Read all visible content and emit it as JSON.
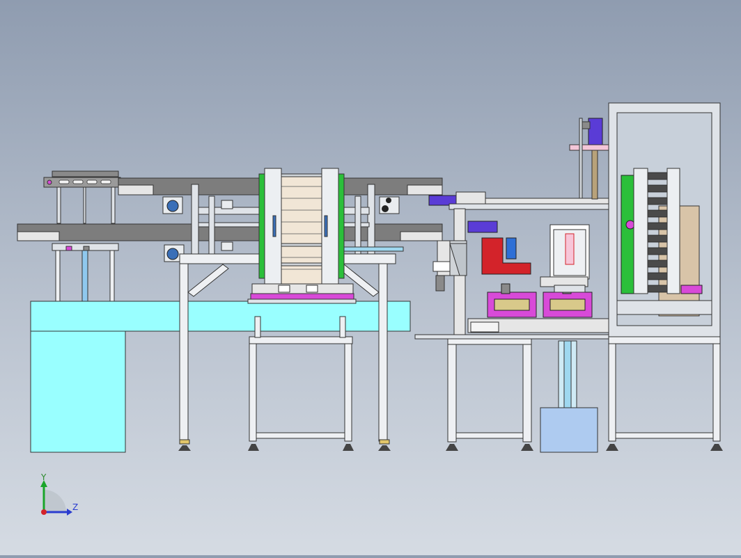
{
  "triad": {
    "y_label": "Y",
    "z_label": "Z"
  },
  "colors": {
    "frame": "#dfe3e8",
    "frame_stroke": "#4a4a4a",
    "table_cyan": "#99ffff",
    "conveyor_gray": "#7d7d7d",
    "sheet_beige": "#f1e6d6",
    "plate_green": "#2bbf3a",
    "actuator_blue": "#5a3cd6",
    "bracket_red": "#d3232a",
    "bin_blue": "#aecbf0",
    "magenta": "#d84ad8"
  }
}
